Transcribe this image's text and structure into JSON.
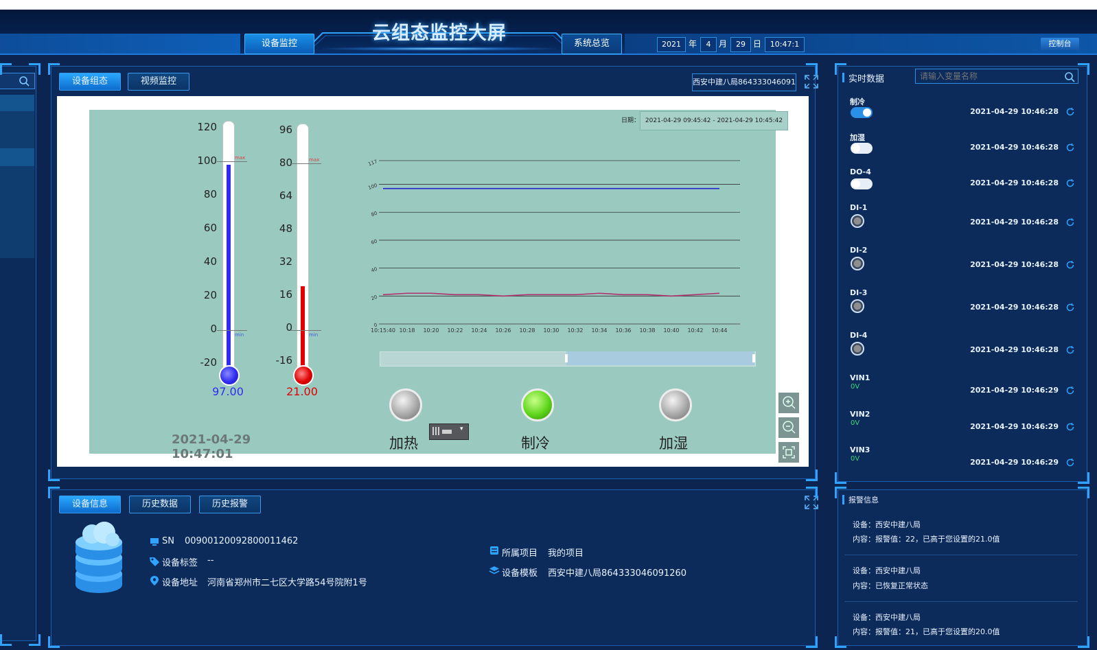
{
  "header": {
    "title": "云组态监控大屏",
    "nav_device": "设备监控",
    "nav_system": "系统总览",
    "date": {
      "year": "2021",
      "year_lbl": "年",
      "month": "4",
      "month_lbl": "月",
      "day": "29",
      "day_lbl": "日",
      "time": "10:47:1"
    },
    "console": "控制台"
  },
  "main_tabs": [
    "设备组态",
    "视频监控"
  ],
  "device_name_field": "西安中建八局864333046091",
  "thermometers": [
    {
      "ticks": [
        "120",
        "100",
        "80",
        "60",
        "40",
        "20",
        "0",
        "-20"
      ],
      "value_text": "97.00",
      "value": 97,
      "min": -20,
      "max": 120,
      "color": "#2f2cf0"
    },
    {
      "ticks": [
        "96",
        "80",
        "64",
        "48",
        "32",
        "16",
        "0",
        "-16"
      ],
      "value_text": "21.00",
      "value": 21,
      "min": -16,
      "max": 96,
      "color": "#e00000"
    }
  ],
  "max_lbl": "max",
  "min_lbl": "min",
  "screen_clock": "2021-04-29 10:47:01",
  "chart_range_lbl": "日期：",
  "chart_range": "2021-04-29 09:45:42 - 2021-04-29 10:45:42",
  "chart_data": {
    "type": "line",
    "ylim": [
      0,
      117
    ],
    "yticks": [
      "117",
      "100",
      "80",
      "60",
      "40",
      "20",
      "0"
    ],
    "xticks": [
      "10:15:40",
      "10:18",
      "10:20",
      "10:22",
      "10:24",
      "10:26",
      "10:28",
      "10:30",
      "10:32",
      "10:34",
      "10:36",
      "10:38",
      "10:40",
      "10:42",
      "10:44"
    ],
    "series": [
      {
        "color": "#2222cc",
        "values": [
          97,
          97,
          97,
          97,
          97,
          97,
          97,
          97,
          97,
          97,
          97,
          97,
          97,
          97,
          97
        ]
      },
      {
        "color": "#b0306b",
        "values": [
          21,
          22,
          22,
          21,
          21,
          20,
          21,
          21,
          21,
          22,
          21,
          21,
          20,
          21,
          22
        ]
      }
    ]
  },
  "lamps": [
    {
      "label": "加热",
      "state": "off"
    },
    {
      "label": "制冷",
      "state": "on"
    },
    {
      "label": "加湿",
      "state": "off"
    }
  ],
  "bottom_tabs": [
    "设备信息",
    "历史数据",
    "历史报警"
  ],
  "device_info": {
    "sn_lbl": "SN",
    "sn": "00900120092800011462",
    "tag_lbl": "设备标签",
    "tag": "--",
    "addr_lbl": "设备地址",
    "addr": "河南省郑州市二七区大学路54号院附1号",
    "project_lbl": "所属项目",
    "project": "我的项目",
    "template_lbl": "设备模板",
    "template": "西安中建八局864333046091260"
  },
  "realtime": {
    "title": "实时数据",
    "search_placeholder": "请输入变量名称",
    "items": [
      {
        "name": "制冷",
        "kind": "toggle-on",
        "time": "2021-04-29 10:46:28"
      },
      {
        "name": "加湿",
        "kind": "toggle-off",
        "time": "2021-04-29 10:46:28"
      },
      {
        "name": "DO-4",
        "kind": "toggle-off",
        "time": "2021-04-29 10:46:28"
      },
      {
        "name": "DI-1",
        "kind": "di",
        "time": "2021-04-29 10:46:28"
      },
      {
        "name": "DI-2",
        "kind": "di",
        "time": "2021-04-29 10:46:28"
      },
      {
        "name": "DI-3",
        "kind": "di",
        "time": "2021-04-29 10:46:28"
      },
      {
        "name": "DI-4",
        "kind": "di",
        "time": "2021-04-29 10:46:28"
      },
      {
        "name": "VIN1",
        "kind": "value",
        "value": "0V",
        "time": "2021-04-29 10:46:29"
      },
      {
        "name": "VIN2",
        "kind": "value",
        "value": "0V",
        "time": "2021-04-29 10:46:29"
      },
      {
        "name": "VIN3",
        "kind": "value",
        "value": "0V",
        "time": "2021-04-29 10:46:29"
      }
    ]
  },
  "alarms": {
    "title": "报警信息",
    "items": [
      {
        "device": "设备：西安中建八局",
        "content": "内容：报警值：22，已高于您设置的21.0值"
      },
      {
        "device": "设备：西安中建八局",
        "content": "内容：已恢复正常状态"
      },
      {
        "device": "设备：西安中建八局",
        "content": "内容：报警值：21，已高于您设置的20.0值"
      }
    ]
  },
  "colors": {
    "accent": "#2fa3ff",
    "bg": "#0b2450",
    "screen": "#9ac9c0",
    "lamp_on": "#5fd61c"
  }
}
